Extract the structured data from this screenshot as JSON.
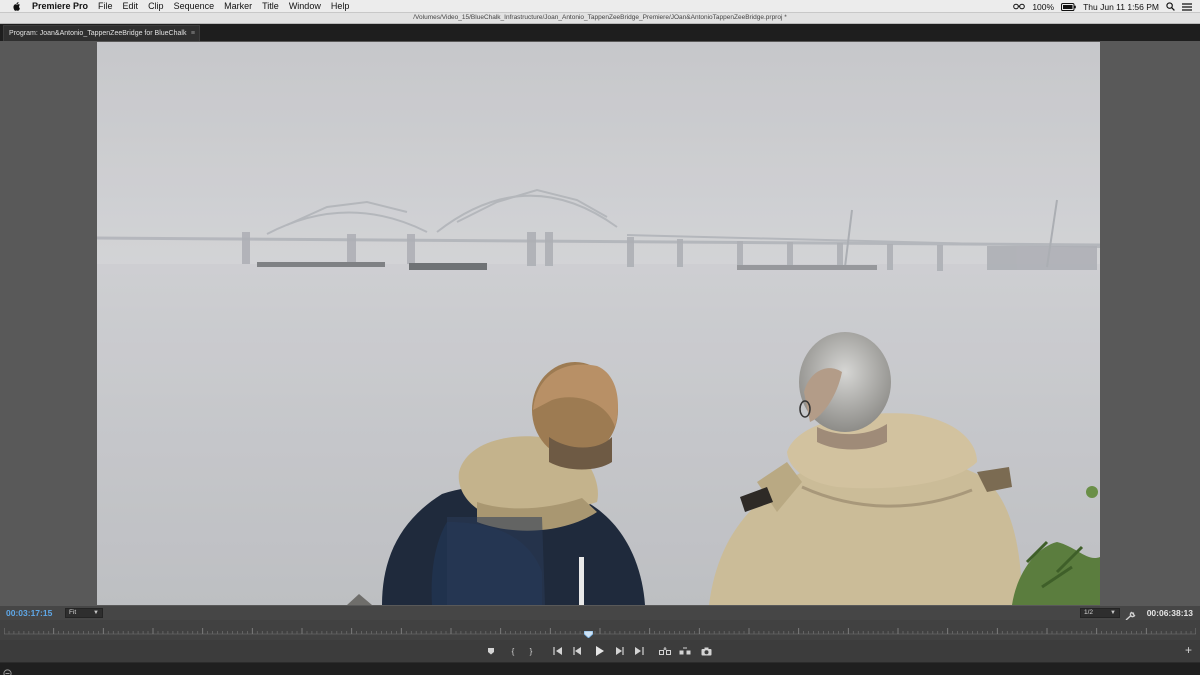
{
  "menubar": {
    "app_name": "Premiere Pro",
    "items": [
      "File",
      "Edit",
      "Clip",
      "Sequence",
      "Marker",
      "Title",
      "Window",
      "Help"
    ],
    "battery": "100%",
    "datetime": "Thu Jun 11  1:56 PM"
  },
  "window": {
    "title": "/Volumes/Video_15/BlueChalk_Infrastructure/Joan_Antonio_TappenZeeBridge_Premiere/JOan&AntonioTappenZeeBridge.prproj *"
  },
  "panel": {
    "tab_label": "Program: Joan&Antonio_TappenZeeBridge for BlueChalk",
    "menu_icon": "panel-menu-icon"
  },
  "monitor": {
    "current_timecode": "00:03:17:15",
    "duration_timecode": "00:06:38:13",
    "zoom_value": "Fit",
    "resolution_value": "1/2",
    "playhead_position": 0.49
  },
  "transport": {
    "buttons": [
      {
        "name": "add-marker-icon"
      },
      {
        "name": "mark-in-icon"
      },
      {
        "name": "mark-out-icon"
      },
      {
        "name": "go-to-in-icon"
      },
      {
        "name": "step-back-icon"
      },
      {
        "name": "play-icon"
      },
      {
        "name": "step-forward-icon"
      },
      {
        "name": "go-to-out-icon"
      },
      {
        "name": "lift-icon"
      },
      {
        "name": "extract-icon"
      },
      {
        "name": "export-frame-icon"
      }
    ],
    "button_editor_label": "+"
  },
  "colors": {
    "timecode_accent": "#5fa8e8",
    "panel_bg": "#595959",
    "app_bg": "#232323"
  }
}
